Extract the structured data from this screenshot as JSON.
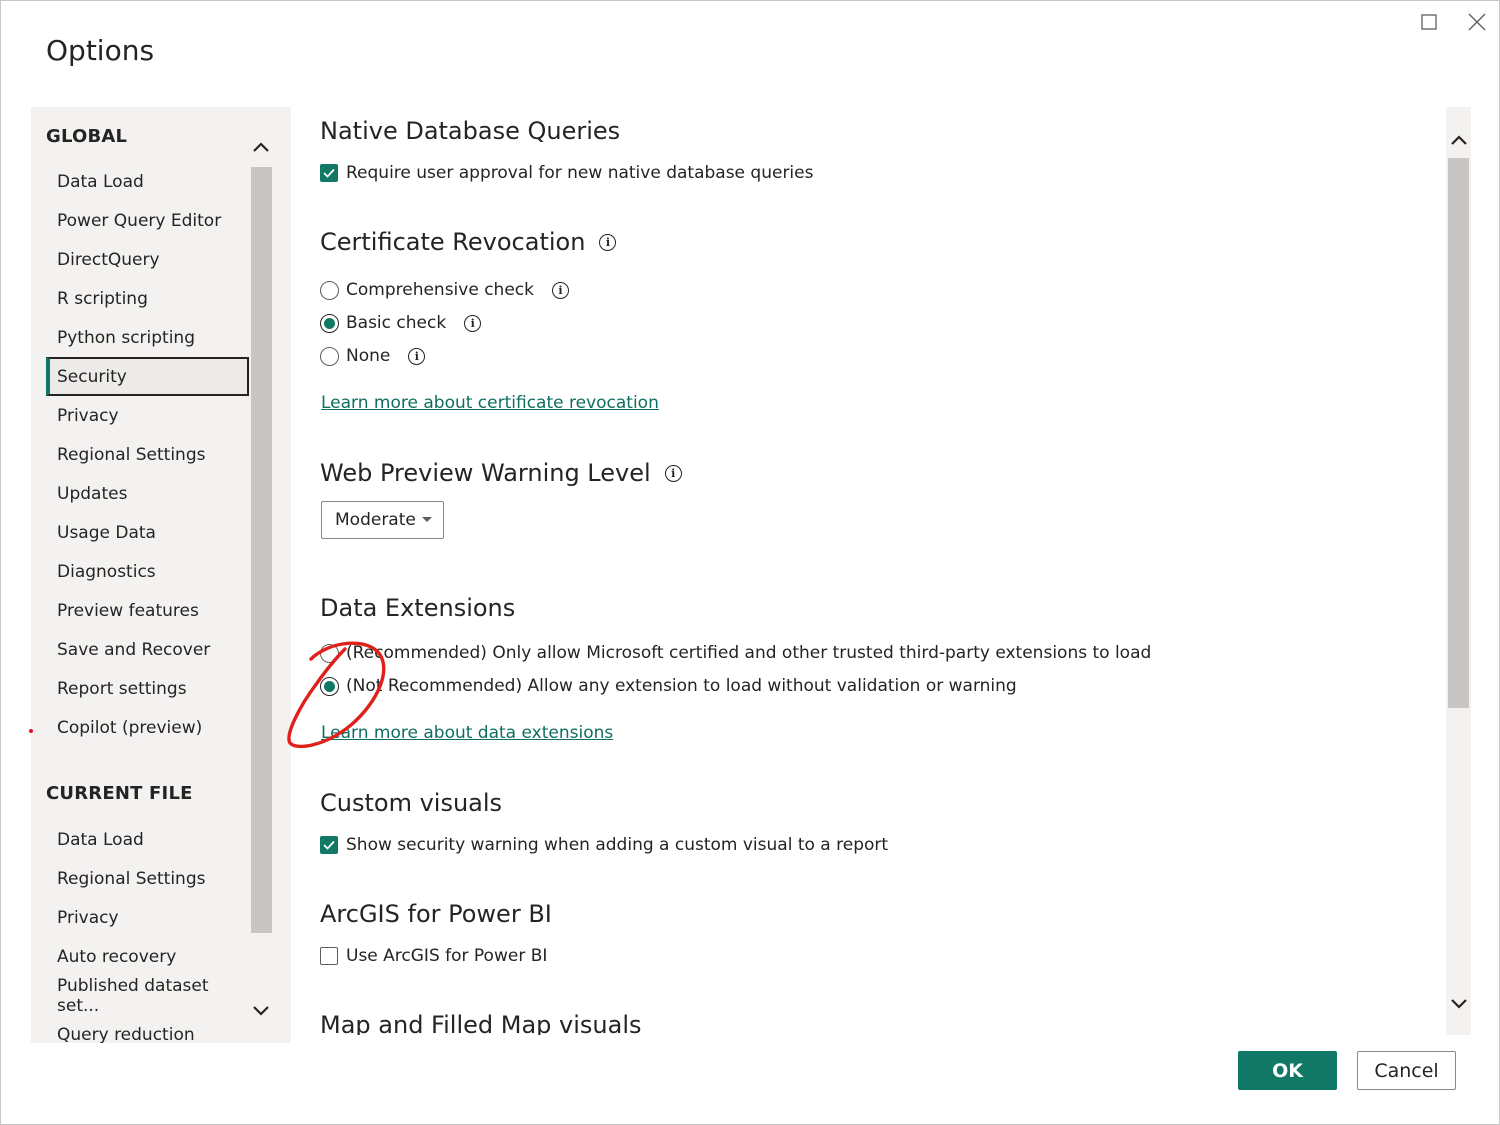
{
  "dialog": {
    "title": "Options"
  },
  "window_controls": {
    "maximize": "maximize-icon",
    "close": "close-icon"
  },
  "nav": {
    "global_header": "GLOBAL",
    "global_items": [
      {
        "label": "Data Load"
      },
      {
        "label": "Power Query Editor"
      },
      {
        "label": "DirectQuery"
      },
      {
        "label": "R scripting"
      },
      {
        "label": "Python scripting"
      },
      {
        "label": "Security",
        "selected": true
      },
      {
        "label": "Privacy"
      },
      {
        "label": "Regional Settings"
      },
      {
        "label": "Updates"
      },
      {
        "label": "Usage Data"
      },
      {
        "label": "Diagnostics"
      },
      {
        "label": "Preview features"
      },
      {
        "label": "Save and Recover"
      },
      {
        "label": "Report settings"
      },
      {
        "label": "Copilot (preview)"
      }
    ],
    "current_header": "CURRENT FILE",
    "current_items": [
      {
        "label": "Data Load"
      },
      {
        "label": "Regional Settings"
      },
      {
        "label": "Privacy"
      },
      {
        "label": "Auto recovery"
      },
      {
        "label": "Published dataset set..."
      },
      {
        "label": "Query reduction"
      }
    ]
  },
  "content": {
    "native": {
      "title": "Native Database Queries",
      "option": "Require user approval for new native database queries",
      "checked": true
    },
    "cert": {
      "title": "Certificate Revocation",
      "options": [
        {
          "label": "Comprehensive check",
          "selected": false
        },
        {
          "label": "Basic check",
          "selected": true
        },
        {
          "label": "None",
          "selected": false
        }
      ],
      "link": "Learn more about certificate revocation"
    },
    "web": {
      "title": "Web Preview Warning Level",
      "value": "Moderate"
    },
    "ext": {
      "title": "Data Extensions",
      "options": [
        {
          "label": "(Recommended) Only allow Microsoft certified and other trusted third-party extensions to load",
          "selected": false
        },
        {
          "label": "(Not Recommended) Allow any extension to load without validation or warning",
          "selected": true
        }
      ],
      "link": "Learn more about data extensions"
    },
    "visuals": {
      "title": "Custom visuals",
      "option": "Show security warning when adding a custom visual to a report",
      "checked": true
    },
    "arcgis": {
      "title": "ArcGIS for Power BI",
      "option": "Use ArcGIS for Power BI",
      "checked": false
    },
    "map": {
      "title": "Map and Filled Map visuals"
    }
  },
  "buttons": {
    "ok": "OK",
    "cancel": "Cancel"
  },
  "colors": {
    "accent": "#117865",
    "link": "#0f6e5f",
    "annotation": "#e0201b"
  }
}
